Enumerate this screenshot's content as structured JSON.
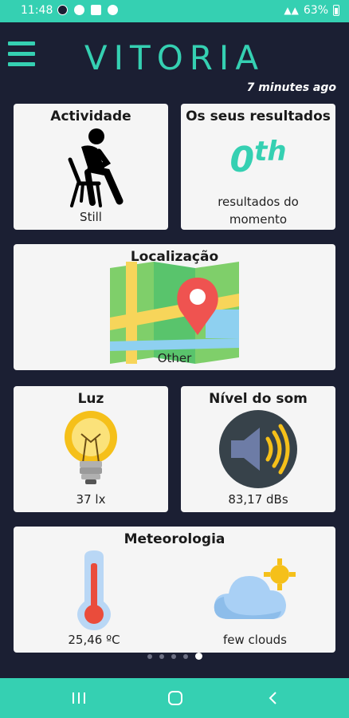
{
  "status_bar": {
    "time": "11:48",
    "battery": "63%"
  },
  "header": {
    "title": "VITORIA",
    "updated": "7 minutes ago"
  },
  "cards": {
    "activity": {
      "title": "Actividade",
      "value": "Still"
    },
    "results": {
      "title": "Os seus resultados",
      "rank_number": "0",
      "rank_suffix": "th",
      "subtitle_line1": "resultados do",
      "subtitle_line2": "momento"
    },
    "location": {
      "title": "Localização",
      "value": "Other"
    },
    "light": {
      "title": "Luz",
      "value": "37 lx"
    },
    "sound": {
      "title": "Nível do som",
      "value": "83,17 dBs"
    },
    "weather": {
      "title": "Meteorologia",
      "temperature": "25,46 ºC",
      "condition": "few clouds"
    }
  },
  "pager": {
    "count": 5,
    "active_index": 4
  },
  "colors": {
    "accent": "#35d0b2",
    "background": "#1b1f33",
    "card": "#f5f5f5"
  },
  "icons": {
    "menu": "hamburger-menu-icon",
    "activity": "person-sitting-icon",
    "location": "map-pin-icon",
    "light": "light-bulb-icon",
    "sound": "speaker-icon",
    "temperature": "thermometer-icon",
    "weather": "sun-behind-cloud-icon"
  }
}
